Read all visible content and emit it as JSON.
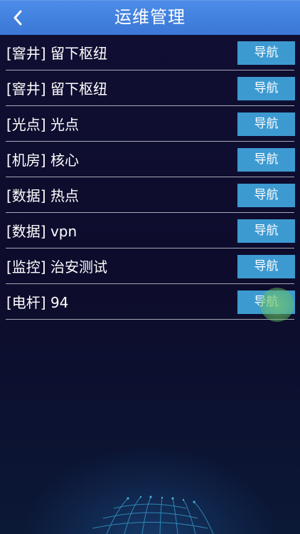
{
  "header": {
    "title": "运维管理",
    "back_icon": "chevron-left-icon"
  },
  "list": {
    "items": [
      {
        "label": "[窨井] 留下枢纽",
        "button": "导航"
      },
      {
        "label": "[窨井] 留下枢纽",
        "button": "导航"
      },
      {
        "label": "[光点] 光点",
        "button": "导航"
      },
      {
        "label": "[机房] 核心",
        "button": "导航"
      },
      {
        "label": "[数据] 热点",
        "button": "导航"
      },
      {
        "label": "[数据] vpn",
        "button": "导航"
      },
      {
        "label": "[监控] 治安测试",
        "button": "导航"
      },
      {
        "label": "[电杆] 94",
        "button": "导航"
      }
    ]
  },
  "colors": {
    "header_bg": "#3f7fdc",
    "background": "#0c0b2a",
    "button_bg": "#3d9ad1",
    "divider": "#a6a9b6",
    "text": "#ffffff",
    "touch_feedback": "#78c86e"
  }
}
